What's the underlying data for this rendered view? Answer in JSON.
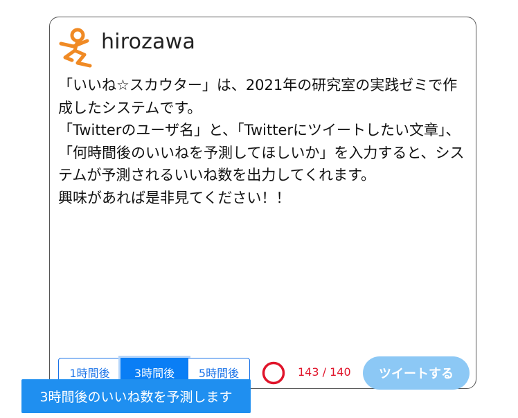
{
  "profile": {
    "username": "hirozawa",
    "avatar_icon": "stick-figure-logo-icon",
    "avatar_color": "#f08a24"
  },
  "description": "「いいね☆スカウター」は、2021年の研究室の実践ゼミで作成したシステムです。\n「Twitterのユーザ名」と、「Twitterにツイートしたい文章」、「何時間後のいいねを予測してほしいか」を入力すると、システムが予測されるいいね数を出力してくれます。\n興味があれば是非見てください！！",
  "time_options": {
    "items": [
      "1時間後",
      "3時間後",
      "5時間後"
    ],
    "selected": "3時間後",
    "accent_color": "#0a7ef5"
  },
  "char_counter": {
    "text": "143 / 140",
    "over_limit": true,
    "color": "#e0142a"
  },
  "tweet_button": {
    "label": "ツイートする",
    "disabled": true,
    "color": "#8cc8f5"
  },
  "tooltip": {
    "text": "3時間後のいいね数を予測します"
  }
}
